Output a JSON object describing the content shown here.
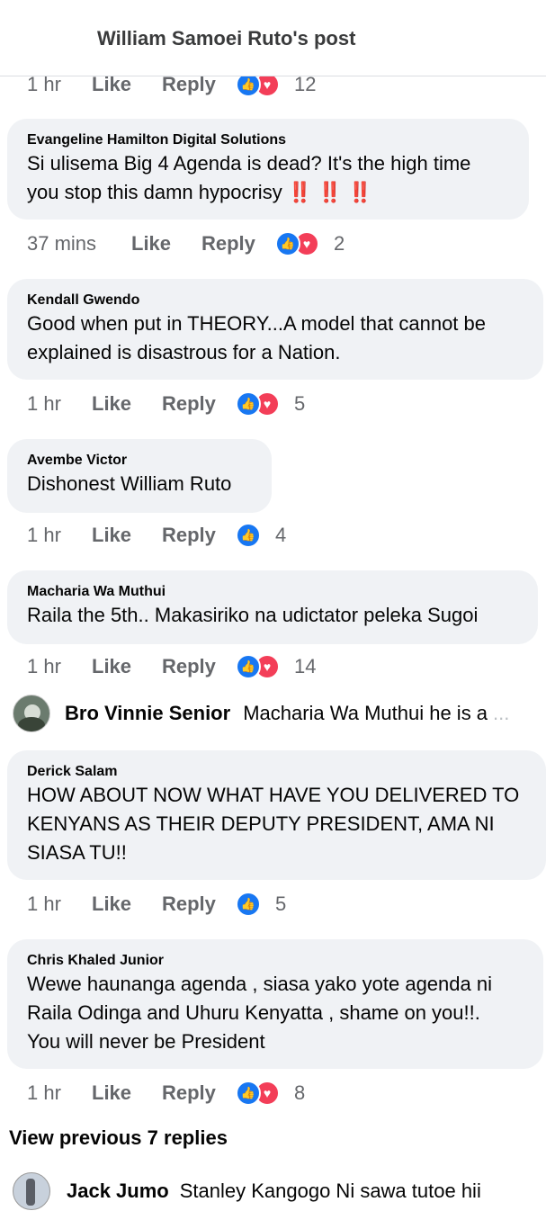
{
  "header": {
    "title": "William Samoei Ruto's post"
  },
  "top_actions": {
    "time": "1 hr",
    "like": "Like",
    "reply": "Reply",
    "count": "12"
  },
  "comments": [
    {
      "author": "Evangeline Hamilton Digital Solutions",
      "text_lines": [
        "Si ulisema Big 4 Agenda is dead? It's the high time",
        "you stop this damn hypocrisy ‼️ ‼️ ‼️"
      ],
      "time": "37 mins",
      "like": "Like",
      "reply": "Reply",
      "count": "2"
    },
    {
      "author": "Kendall Gwendo",
      "text_lines": [
        "Good when put in THEORY...A model that cannot be",
        "explained is disastrous for a Nation."
      ],
      "time": "1 hr",
      "like": "Like",
      "reply": "Reply",
      "count": "5"
    },
    {
      "author": "Avembe Victor",
      "text_lines": [
        "Dishonest William Ruto"
      ],
      "time": "1 hr",
      "like": "Like",
      "reply": "Reply",
      "count": "4"
    },
    {
      "author": "Macharia Wa Muthui",
      "text_lines": [
        "Raila the 5th.. Makasiriko na udictator peleka Sugoi"
      ],
      "time": "1 hr",
      "like": "Like",
      "reply": "Reply",
      "count": "14"
    },
    {
      "author": "Derick Salam",
      "text_lines": [
        "HOW ABOUT NOW WHAT HAVE YOU DELIVERED TO",
        "KENYANS AS THEIR DEPUTY PRESIDENT, AMA NI",
        "SIASA TU!!"
      ],
      "time": "1 hr",
      "like": "Like",
      "reply": "Reply",
      "count": "5"
    },
    {
      "author": "Chris Khaled Junior",
      "text_lines": [
        "Wewe haunanga agenda , siasa yako yote agenda ni",
        "Raila Odinga and Uhuru Kenyatta , shame on you!!.",
        "You will never be President"
      ],
      "time": "1 hr",
      "like": "Like",
      "reply": "Reply",
      "count": "8"
    }
  ],
  "inline_reply": {
    "name": "Bro Vinnie Senior",
    "text": "Macharia Wa Muthui he is a",
    "ellipsis": "..."
  },
  "view_previous": "View previous 7 replies",
  "bottom_reply": {
    "name": "Jack Jumo",
    "text": "Stanley Kangogo Ni sawa tutoe hii"
  },
  "colors": {
    "like_reaction": "#1877f2",
    "love_reaction": "#f33e58",
    "bubble": "#f0f2f5",
    "meta_text": "#65676b"
  },
  "icons": {
    "like": "thumbs-up-icon",
    "love": "heart-icon"
  }
}
